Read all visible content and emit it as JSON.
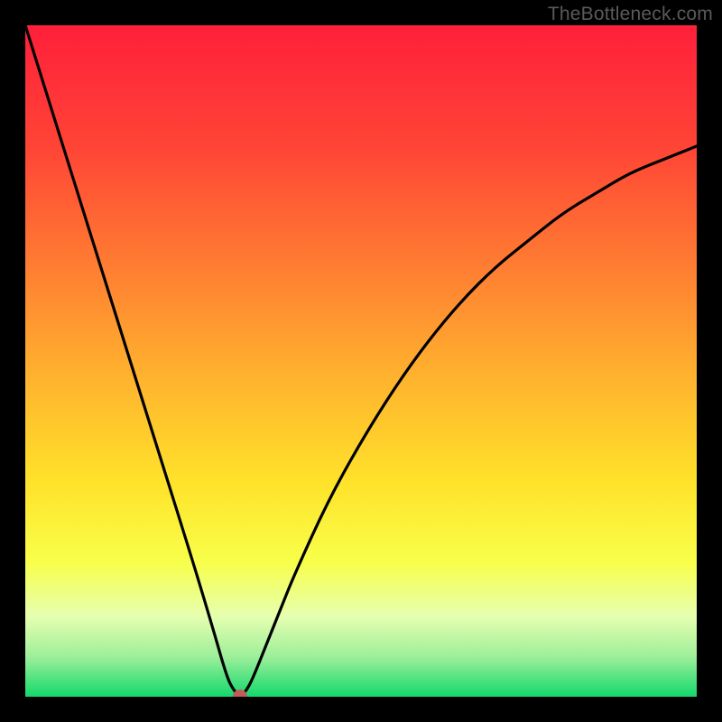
{
  "watermark": {
    "text": "TheBottleneck.com"
  },
  "chart_data": {
    "type": "line",
    "title": "",
    "xlabel": "",
    "ylabel": "",
    "xlim": [
      0,
      100
    ],
    "ylim": [
      0,
      100
    ],
    "x": [
      0,
      5,
      10,
      15,
      20,
      25,
      28,
      30,
      31,
      32,
      33,
      34,
      36,
      38,
      40,
      45,
      50,
      55,
      60,
      65,
      70,
      75,
      80,
      85,
      90,
      95,
      100
    ],
    "values": [
      100,
      84,
      68,
      52,
      36,
      20,
      10,
      3,
      1,
      0,
      1,
      3,
      8,
      13,
      18,
      29,
      38,
      46,
      53,
      59,
      64,
      68,
      72,
      75,
      78,
      80,
      82
    ],
    "marker": {
      "x": 32,
      "y": 0
    },
    "gradient_stops": [
      {
        "offset": 0,
        "color": "#ff1f3a"
      },
      {
        "offset": 0.18,
        "color": "#ff4436"
      },
      {
        "offset": 0.35,
        "color": "#ff7a32"
      },
      {
        "offset": 0.52,
        "color": "#ffb12e"
      },
      {
        "offset": 0.68,
        "color": "#ffe22a"
      },
      {
        "offset": 0.8,
        "color": "#f8ff4a"
      },
      {
        "offset": 0.88,
        "color": "#e6ffb0"
      },
      {
        "offset": 0.94,
        "color": "#9eef9a"
      },
      {
        "offset": 1.0,
        "color": "#13d86c"
      }
    ]
  }
}
